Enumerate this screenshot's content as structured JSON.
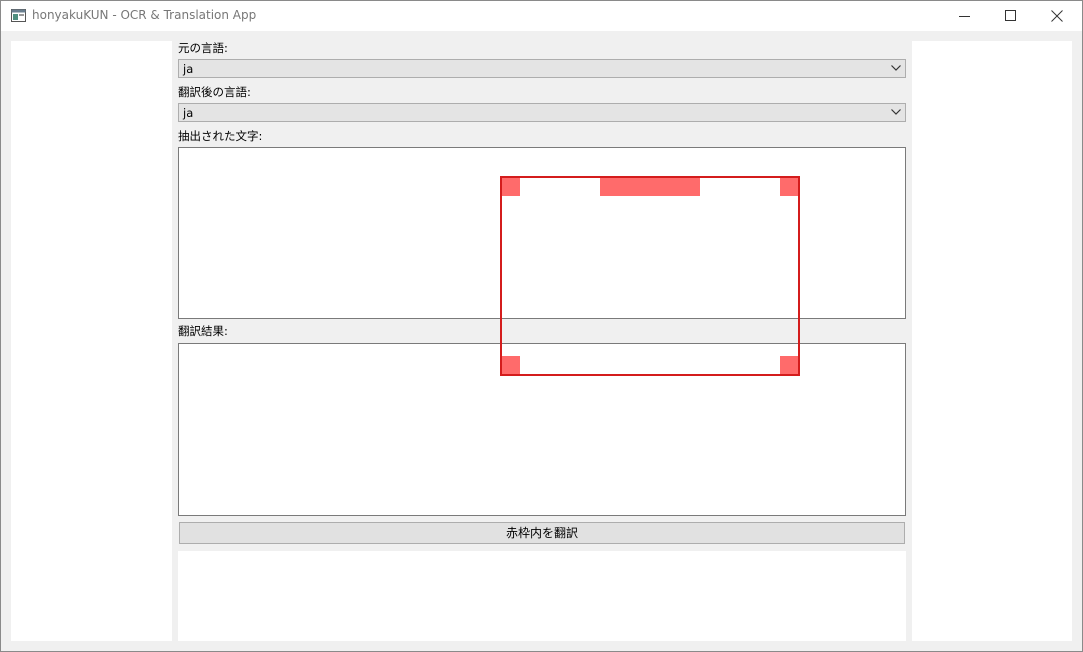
{
  "window": {
    "title": "honyakuKUN - OCR & Translation App"
  },
  "source_language": {
    "label": "元の言語:",
    "selected": "ja"
  },
  "target_language": {
    "label": "翻訳後の言語:",
    "selected": "ja"
  },
  "extracted_text": {
    "label": "抽出された文字:",
    "value": ""
  },
  "translation_result": {
    "label": "翻訳結果:",
    "value": ""
  },
  "actions": {
    "translate_label": "赤枠内を翻訳"
  },
  "colors": {
    "frame_border": "#d41c1c",
    "frame_handle": "#ff6b6b"
  }
}
